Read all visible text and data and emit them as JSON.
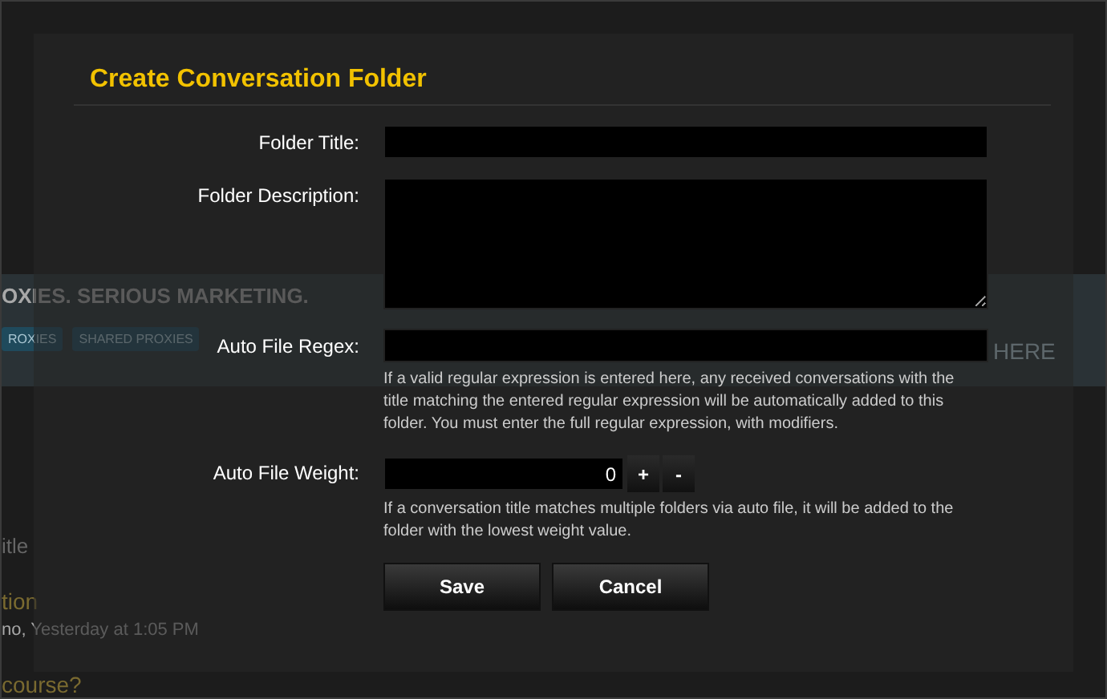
{
  "background_page": {
    "banner_headline": "OXIES. SERIOUS MARKETING.",
    "banner_buttons": [
      "ROXIES",
      "SHARED PROXIES"
    ],
    "banner_link": "HERE",
    "column_label": "itle",
    "thread_title": "tion",
    "thread_meta": "no, Yesterday at 1:05 PM",
    "next_thread_title": "course?"
  },
  "dialog": {
    "title": "Create Conversation Folder",
    "fields": [
      {
        "kind": "text",
        "label": "Folder Title:"
      },
      {
        "kind": "textarea",
        "label": "Folder Description:"
      },
      {
        "kind": "text",
        "label": "Auto File Regex:",
        "hint": "If a valid regular expression is entered here, any received conversations with the title matching the entered regular expression will be automatically added to this folder. You must enter the full regular expression, with modifiers."
      },
      {
        "kind": "number",
        "label": "Auto File Weight:",
        "value": "0",
        "increment": "+",
        "decrement": "-",
        "hint": "If a conversation title matches multiple folders via auto file, it will be added to the folder with the lowest weight value."
      }
    ],
    "buttons": [
      "Save",
      "Cancel"
    ]
  }
}
